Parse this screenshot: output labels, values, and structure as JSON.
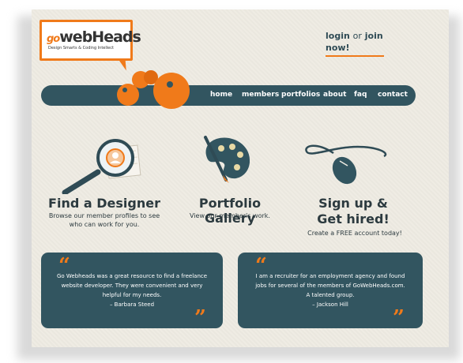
{
  "brand": {
    "logo_go": "go",
    "logo_name": "webHeads",
    "tagline": "Design Smarts & Coding Intellect"
  },
  "header": {
    "login_label": "login",
    "or_label": "or",
    "join_label": "join",
    "now_label": "now!"
  },
  "nav": {
    "items": [
      "home",
      "members",
      "portfolios",
      "about",
      "faq",
      "contact"
    ]
  },
  "features": [
    {
      "title": "Find a Designer",
      "text": "Browse our member profiles to see who can work for you.",
      "icon": "magnifier-icon"
    },
    {
      "title": "Portfolio Gallery",
      "text": "View our member's work.",
      "icon": "palette-icon"
    },
    {
      "title_line1": "Sign up &",
      "title_line2": "Get hired!",
      "text": "Create a FREE account today!",
      "icon": "mouse-icon"
    }
  ],
  "testimonials": [
    {
      "quote": "Go Webheads was a great resource to find a freelance website developer. They were convenient and very helpful for my needs.",
      "author": "– Barbara Steed"
    },
    {
      "quote": "I am a recruiter for an employment agency and found jobs for several of the members of GoWebHeads.com. A talented group.",
      "author": "– Jackson Hill"
    }
  ],
  "colors": {
    "accent": "#f07a1a",
    "primary": "#325560",
    "background": "#efece3"
  }
}
